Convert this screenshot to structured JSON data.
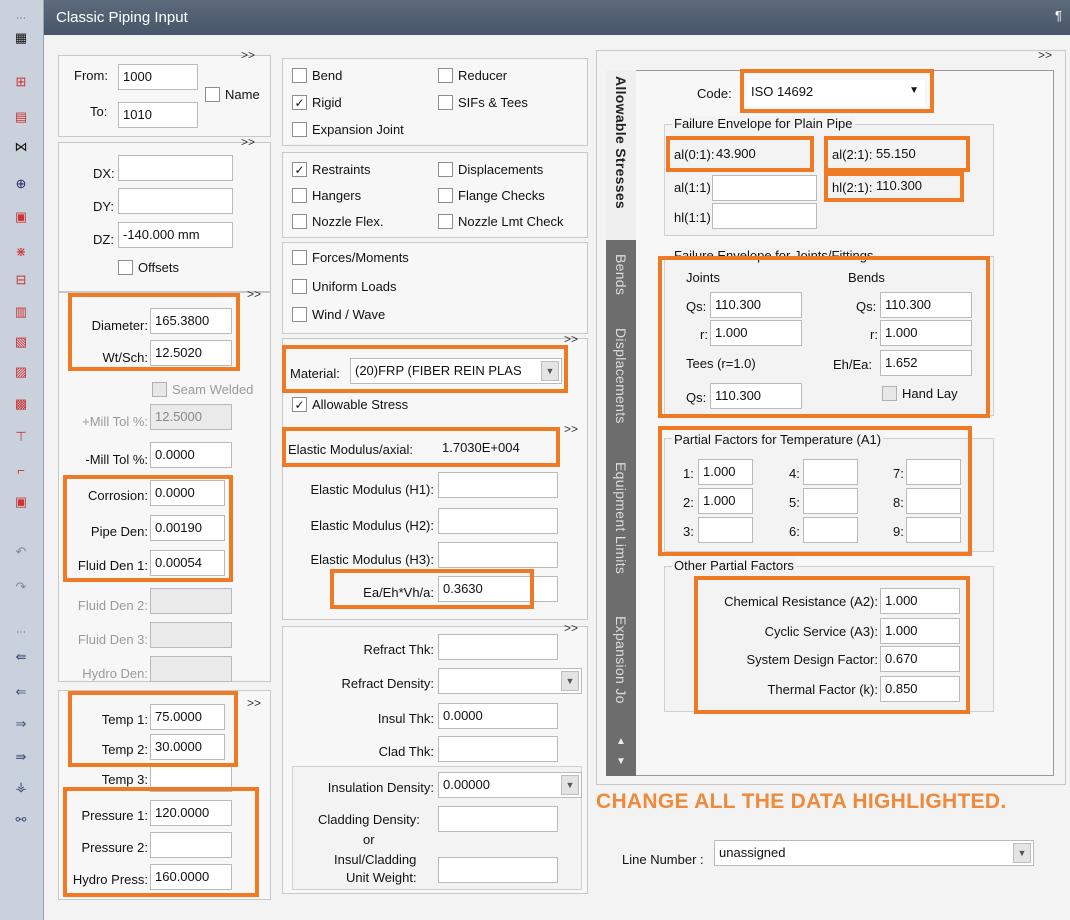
{
  "window": {
    "title": "Classic Piping Input",
    "pin_glyph": "¶",
    "more_glyph": ">>"
  },
  "toolbar": {
    "icons": [
      "grid-icon",
      "node-icon",
      "doc-icon",
      "split-icon",
      "circle-icon",
      "box-icon",
      "valve-icon",
      "flange-icon",
      "list-icon",
      "list2-icon",
      "list3-icon",
      "list4-icon",
      "red-icon",
      "elbow-icon",
      "doc2-icon",
      "undo-icon",
      "redo-icon",
      "dots-icon",
      "arrow-left-icon",
      "arrow-left2-icon",
      "arrow-right-icon",
      "double-arrow-icon",
      "tree-icon",
      "binoculars-icon"
    ]
  },
  "nodes": {
    "from_label": "From:",
    "from_value": "1000",
    "to_label": "To:",
    "to_value": "1010",
    "name_label": "Name"
  },
  "deltas": {
    "dx_label": "DX:",
    "dx_value": "",
    "dy_label": "DY:",
    "dy_value": "",
    "dz_label": "DZ:",
    "dz_value": "-140.000 mm",
    "offsets_label": "Offsets"
  },
  "pipe": {
    "diameter_label": "Diameter:",
    "diameter_value": "165.3800",
    "wtsch_label": "Wt/Sch:",
    "wtsch_value": "12.5020",
    "seam_label": "Seam Welded",
    "plus_mill_label": "+Mill Tol %:",
    "plus_mill_value": "12.5000",
    "minus_mill_label": "-Mill Tol %:",
    "minus_mill_value": "0.0000",
    "corrosion_label": "Corrosion:",
    "corrosion_value": "0.0000",
    "pipe_den_label": "Pipe Den:",
    "pipe_den_value": "0.00190",
    "fluid1_label": "Fluid Den 1:",
    "fluid1_value": "0.00054",
    "fluid2_label": "Fluid Den 2:",
    "fluid3_label": "Fluid Den 3:",
    "hydro_den_label": "Hydro Den:"
  },
  "operating": {
    "temp1_label": "Temp 1:",
    "temp1_value": "75.0000",
    "temp2_label": "Temp 2:",
    "temp2_value": "30.0000",
    "temp3_label": "Temp 3:",
    "press1_label": "Pressure 1:",
    "press1_value": "120.0000",
    "press2_label": "Pressure 2:",
    "hydro_label": "Hydro Press:",
    "hydro_value": "160.0000"
  },
  "elements": {
    "bend": "Bend",
    "rigid": "Rigid",
    "expansion": "Expansion Joint",
    "reducer": "Reducer",
    "sifs": "SIFs & Tees"
  },
  "aux": {
    "restraints": "Restraints",
    "hangers": "Hangers",
    "nozzle": "Nozzle Flex.",
    "displacements": "Displacements",
    "flange": "Flange Checks",
    "nozzle_lmt": "Nozzle Lmt Check"
  },
  "loads": {
    "forces": "Forces/Moments",
    "uniform": "Uniform Loads",
    "wind": "Wind / Wave"
  },
  "material": {
    "material_label": "Material:",
    "material_value": "(20)FRP (FIBER REIN PLAS",
    "allowable_label": "Allowable Stress",
    "em_axial_label": "Elastic Modulus/axial:",
    "em_axial_value": "1.7030E+004",
    "em_h1_label": "Elastic Modulus (H1):",
    "em_h2_label": "Elastic Modulus (H2):",
    "em_h3_label": "Elastic Modulus (H3):",
    "ea_label": "Ea/Eh*Vh/a:",
    "ea_value": "0.3630"
  },
  "insulation": {
    "refract_thk": "Refract Thk:",
    "refract_density": "Refract Density:",
    "insul_thk": "Insul Thk:",
    "insul_thk_value": "0.0000",
    "clad_thk": "Clad Thk:",
    "insul_density": "Insulation Density:",
    "insul_density_value": "0.00000",
    "cladding_density": "Cladding Density:",
    "or": "or",
    "unit_weight_1": "Insul/Cladding",
    "unit_weight_2": "Unit Weight:"
  },
  "tabs": [
    "Allowable Stresses",
    "Bends",
    "Displacements",
    "Equipment Limits",
    "Expansion Jo"
  ],
  "allowable": {
    "code_label": "Code:",
    "code_value": "ISO 14692",
    "plain_title": "Failure Envelope for Plain Pipe",
    "a01_label": "al(0:1):",
    "a01_value": "43.900",
    "a21_label": "al(2:1):",
    "a21_value": "55.150",
    "a11_label": "al(1:1):",
    "h21_label": "hl(2:1):",
    "h21_value": "110.300",
    "h11_label": "hl(1:1):",
    "joints_title": "Failure Envelope for Joints/Fittings",
    "joints": "Joints",
    "bends": "Bends",
    "j_qs_label": "Qs:",
    "j_qs_value": "110.300",
    "j_r_label": "r:",
    "j_r_value": "1.000",
    "b_qs_label": "Qs:",
    "b_qs_value": "110.300",
    "b_r_label": "r:",
    "b_r_value": "1.000",
    "tees_label": "Tees (r=1.0)",
    "t_qs_label": "Qs:",
    "t_qs_value": "110.300",
    "eh_label": "Eh/Ea:",
    "eh_value": "1.652",
    "handlay": "Hand Lay",
    "temp_title": "Partial Factors for Temperature (A1)",
    "t1": "1:",
    "t1v": "1.000",
    "t2": "2:",
    "t2v": "1.000",
    "t3": "3:",
    "t4": "4:",
    "t5": "5:",
    "t6": "6:",
    "t7": "7:",
    "t8": "8:",
    "t9": "9:",
    "other_title": "Other Partial Factors",
    "chem_label": "Chemical Resistance (A2):",
    "chem_value": "1.000",
    "cyclic_label": "Cyclic Service (A3):",
    "cyclic_value": "1.000",
    "sdf_label": "System Design Factor:",
    "sdf_value": "0.670",
    "thermal_label": "Thermal Factor (k):",
    "thermal_value": "0.850"
  },
  "banner": "CHANGE ALL THE DATA HIGHLIGHTED.",
  "line_number": {
    "label": "Line Number :",
    "value": "unassigned"
  },
  "colors": {
    "highlight": "#ee7a26",
    "titlebar": "#4d5a6e",
    "tab_strip": "#6d6d6d"
  }
}
